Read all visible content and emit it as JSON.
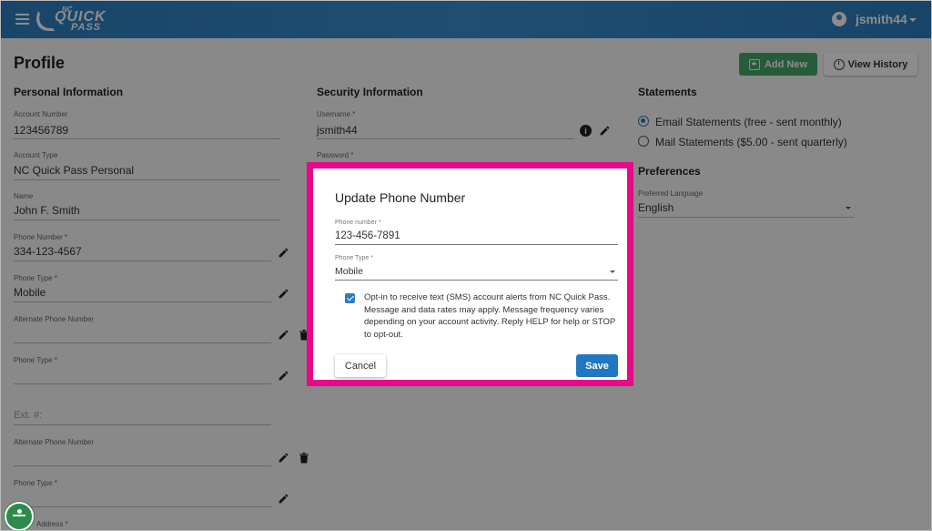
{
  "header": {
    "logo": {
      "nc": "NC",
      "quick": "QUICK",
      "pass": "PASS"
    },
    "username": "jsmith44"
  },
  "page": {
    "title": "Profile",
    "add_new_label": "Add New",
    "view_history_label": "View History"
  },
  "personal": {
    "heading": "Personal Information",
    "account_number_label": "Account Number",
    "account_number": "123456789",
    "account_type_label": "Account Type",
    "account_type": "NC Quick Pass Personal",
    "name_label": "Name",
    "name": "John F. Smith",
    "phone_number_label": "Phone Number *",
    "phone_number": "334-123-4567",
    "phone_type_label": "Phone Type *",
    "phone_type": "Mobile",
    "alt_phone_label": "Alternate Phone Number",
    "alt_phone_type_label": "Phone Type *",
    "ext_placeholder": "Ext. #:",
    "alt_phone_label_2": "Alternate Phone Number",
    "alt_phone_type_label_2": "Phone Type *",
    "address_label": "Address *"
  },
  "security": {
    "heading": "Security Information",
    "username_label": "Username *",
    "username": "jsmith44",
    "password_label": "Password *"
  },
  "statements": {
    "heading": "Statements",
    "options": [
      {
        "label": "Email Statements (free - sent monthly)",
        "selected": true
      },
      {
        "label": "Mail Statements ($5.00 - sent quarterly)",
        "selected": false
      }
    ]
  },
  "preferences": {
    "heading": "Preferences",
    "language_label": "Preferred Language",
    "language": "English"
  },
  "modal": {
    "title": "Update Phone Number",
    "phone_label": "Phone number *",
    "phone_value": "123-456-7891",
    "type_label": "Phone Type *",
    "type_value": "Mobile",
    "optin_checked": true,
    "optin_text": "Opt-in to receive text (SMS) account alerts from NC Quick Pass. Message and data rates may apply. Message frequency varies depending on your account activity. Reply HELP for help or STOP to opt-out.",
    "cancel_label": "Cancel",
    "save_label": "Save",
    "highlight_color": "#e8088a"
  }
}
